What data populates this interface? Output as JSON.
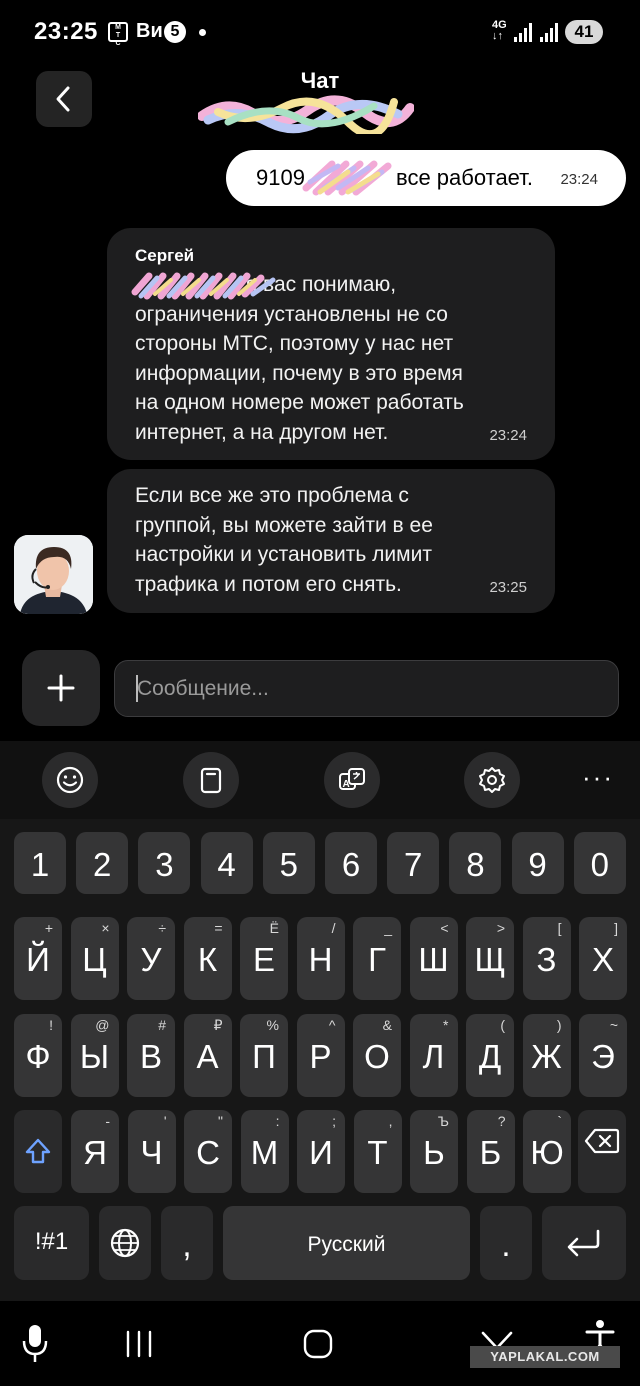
{
  "status_bar": {
    "time": "23:25",
    "operator_logo": "МТС",
    "carrier": "Ви",
    "badge": "5",
    "network_type": "4G",
    "battery": "41"
  },
  "header": {
    "title": "Чат",
    "back_icon": "chevron-left-icon"
  },
  "messages": {
    "outgoing": {
      "text_start": "9109",
      "text_end": "все работает.",
      "time": "23:24"
    },
    "incoming": [
      {
        "sender": "Сергей",
        "text": "                   я вас понимаю,\nограничения установлены не со\nстороны МТС, поэтому у нас нет\nинформации, почему в это время\nна одном номере может работать\nинтернет, а на другом нет.",
        "time": "23:24"
      },
      {
        "text": "Если все же это проблема с\nгруппой, вы можете зайти в ее\nнастройки и установить лимит\nтрафика и потом его снять.",
        "time": "23:25"
      }
    ]
  },
  "composer": {
    "placeholder": "Сообщение...",
    "attach_icon": "plus-icon"
  },
  "keyboard": {
    "toolbar_icons": [
      "emoji-icon",
      "clipboard-icon",
      "translate-icon",
      "settings-icon",
      "more-icon"
    ],
    "more_label": "···",
    "numbers": [
      "1",
      "2",
      "3",
      "4",
      "5",
      "6",
      "7",
      "8",
      "9",
      "0"
    ],
    "row1": [
      {
        "k": "Й",
        "s": "+"
      },
      {
        "k": "Ц",
        "s": "×"
      },
      {
        "k": "У",
        "s": "÷"
      },
      {
        "k": "К",
        "s": "="
      },
      {
        "k": "Е",
        "s": "Ё"
      },
      {
        "k": "Н",
        "s": "/"
      },
      {
        "k": "Г",
        "s": "_"
      },
      {
        "k": "Ш",
        "s": "<"
      },
      {
        "k": "Щ",
        "s": ">"
      },
      {
        "k": "З",
        "s": "["
      },
      {
        "k": "Х",
        "s": "]"
      }
    ],
    "row2": [
      {
        "k": "Ф",
        "s": "!"
      },
      {
        "k": "Ы",
        "s": "@"
      },
      {
        "k": "В",
        "s": "#"
      },
      {
        "k": "А",
        "s": "₽"
      },
      {
        "k": "П",
        "s": "%"
      },
      {
        "k": "Р",
        "s": "^"
      },
      {
        "k": "О",
        "s": "&"
      },
      {
        "k": "Л",
        "s": "*"
      },
      {
        "k": "Д",
        "s": "("
      },
      {
        "k": "Ж",
        "s": ")"
      },
      {
        "k": "Э",
        "s": "~"
      }
    ],
    "row3": [
      {
        "k": "Я",
        "s": "-"
      },
      {
        "k": "Ч",
        "s": "'"
      },
      {
        "k": "С",
        "s": "\""
      },
      {
        "k": "М",
        "s": ":"
      },
      {
        "k": "И",
        "s": ";"
      },
      {
        "k": "Т",
        "s": ","
      },
      {
        "k": "Ь",
        "s": "Ъ"
      },
      {
        "k": "Б",
        "s": "?"
      },
      {
        "k": "Ю",
        "s": "`"
      }
    ],
    "symbols_label": "!#1",
    "comma_label": ",",
    "space_label": "Русский",
    "period_label": "."
  },
  "nav_bar": {
    "icons": [
      "microphone-icon",
      "recent-apps-icon",
      "home-icon",
      "hide-keyboard-icon",
      "accessibility-icon"
    ]
  },
  "watermark": "YAPLAKAL.COM"
}
